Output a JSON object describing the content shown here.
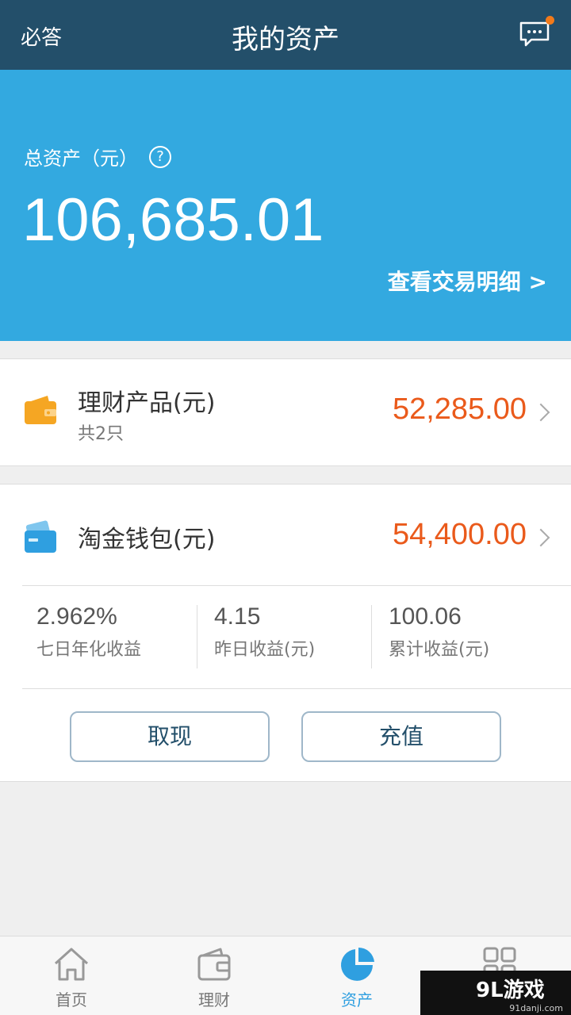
{
  "nav": {
    "left_label": "必答",
    "title": "我的资产",
    "message_icon": "message-icon"
  },
  "hero": {
    "label": "总资产（元）",
    "help_icon": "?",
    "amount": "106,685.01",
    "details_link": "查看交易明细 >"
  },
  "products": {
    "title": "理财产品(元)",
    "subtitle": "共2只",
    "amount": "52,285.00"
  },
  "wallet": {
    "title": "淘金钱包(元)",
    "amount": "54,400.00",
    "stats": [
      {
        "value": "2.962%",
        "label": "七日年化收益"
      },
      {
        "value": "4.15",
        "label": "昨日收益(元)"
      },
      {
        "value": "100.06",
        "label": "累计收益(元)"
      }
    ],
    "withdraw_label": "取现",
    "recharge_label": "充值"
  },
  "tabbar": {
    "items": [
      {
        "label": "首页",
        "icon": "home-icon",
        "active": false
      },
      {
        "label": "理财",
        "icon": "wallet-icon",
        "active": false
      },
      {
        "label": "资产",
        "icon": "pie-chart-icon",
        "active": true
      },
      {
        "label": "",
        "icon": "grid-icon",
        "active": false
      }
    ]
  },
  "watermark": {
    "main": "9L游戏",
    "sub": "91danji.com"
  },
  "colors": {
    "nav_bg": "#234f6a",
    "hero_bg": "#33a9e0",
    "amount": "#ea5a1b",
    "active_tab": "#2f9fe0"
  }
}
